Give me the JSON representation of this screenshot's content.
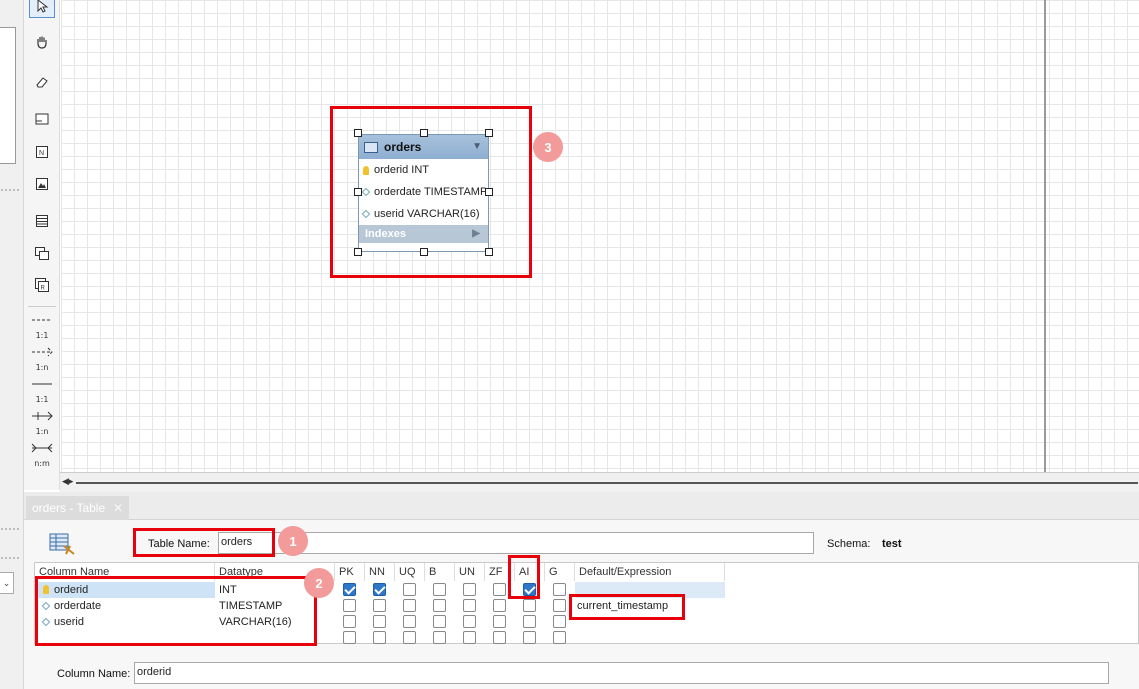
{
  "entity": {
    "name": "orders",
    "columns": [
      "orderid INT",
      "orderdate TIMESTAMP",
      "userid VARCHAR(16)"
    ],
    "indexes_label": "Indexes"
  },
  "relationships": [
    "1:1",
    "1:n",
    "1:1",
    "1:n",
    "n:m"
  ],
  "badges": [
    "1",
    "2",
    "3"
  ],
  "tab": {
    "label": "orders - Table"
  },
  "table_editor": {
    "table_name_label": "Table Name:",
    "table_name": "orders",
    "schema_label": "Schema:",
    "schema": "test",
    "headers": [
      "Column Name",
      "Datatype",
      "PK",
      "NN",
      "UQ",
      "B",
      "UN",
      "ZF",
      "AI",
      "G",
      "Default/Expression"
    ],
    "rows": [
      {
        "name": "orderid",
        "type": "INT",
        "key": "primary-key",
        "pk": true,
        "nn": true,
        "uq": false,
        "b": false,
        "un": false,
        "zf": false,
        "ai": true,
        "g": false,
        "default": ""
      },
      {
        "name": "orderdate",
        "type": "TIMESTAMP",
        "key": "column",
        "pk": false,
        "nn": false,
        "uq": false,
        "b": false,
        "un": false,
        "zf": false,
        "ai": false,
        "g": false,
        "default": "current_timestamp"
      },
      {
        "name": "userid",
        "type": "VARCHAR(16)",
        "key": "column",
        "pk": false,
        "nn": false,
        "uq": false,
        "b": false,
        "un": false,
        "zf": false,
        "ai": false,
        "g": false,
        "default": ""
      }
    ],
    "column_name_label": "Column Name:",
    "column_name": "orderid"
  },
  "colors": {
    "highlight": "#e8000b",
    "badge": "#f39a9a",
    "checkbox_on": "#2f77c9",
    "entity_header": "#a7c1dc"
  }
}
